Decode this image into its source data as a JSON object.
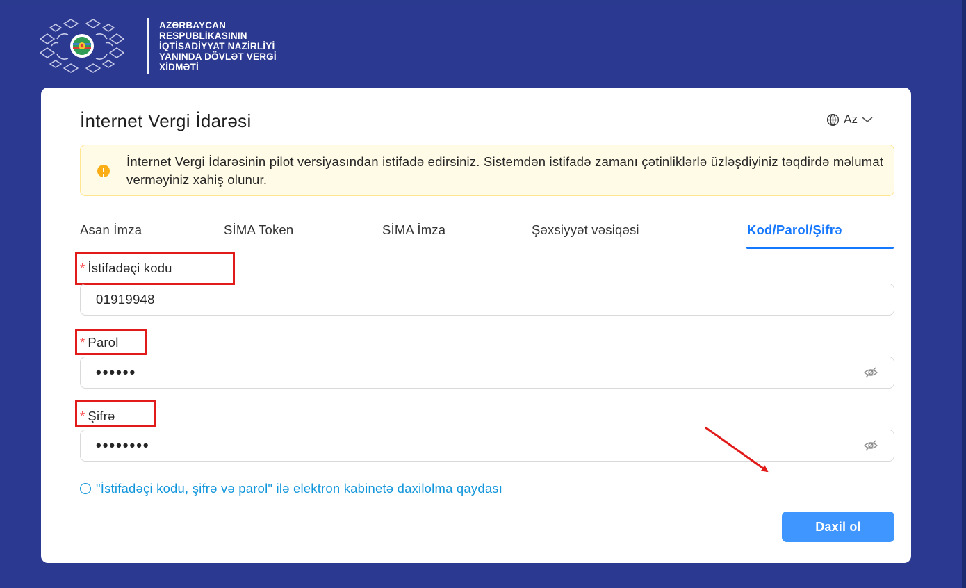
{
  "brand": {
    "lines": [
      "AZƏRBAYCAN",
      "RESPUBLİKASININ",
      "İQTİSADİYYAT NAZİRLİYİ",
      "YANINDA DÖVLƏT VERGİ",
      "XİDMƏTİ"
    ],
    "emblem_icon": "state-emblem-icon"
  },
  "card": {
    "title": "İnternet Vergi İdarəsi",
    "language": {
      "icon": "globe-icon",
      "label": "Az"
    }
  },
  "alert": {
    "icon": "warning-icon",
    "text": "İnternet Vergi İdarəsinin pilot versiyasından istifadə edirsiniz. Sistemdən istifadə zamanı çətinliklərlə üzləşdiyiniz təqdirdə məlumat verməyiniz xahiş olunur."
  },
  "tabs": {
    "items": [
      {
        "label": "Asan İmza"
      },
      {
        "label": "SİMA Token"
      },
      {
        "label": "SİMA İmza"
      },
      {
        "label": "Şəxsiyyət vəsiqəsi"
      },
      {
        "label": "Kod/Parol/Şifrə"
      }
    ],
    "active_index": 4
  },
  "form": {
    "required_marker": "*",
    "user_code": {
      "label": "İstifadəçi kodu",
      "value": "01919948"
    },
    "password": {
      "label": "Parol",
      "value": "••••••"
    },
    "pin": {
      "label": "Şifrə",
      "value": "••••••••"
    }
  },
  "info_link": {
    "icon": "info-circle-icon",
    "text": "\"İstifadəçi kodu, şifrə və parol\" ilə elektron kabinetə daxilolma qaydası"
  },
  "submit": {
    "label": "Daxil ol"
  },
  "colors": {
    "background": "#2b3990",
    "accent": "#1677ff",
    "button": "#4096ff",
    "annotation": "#e11a1a",
    "alert_bg": "#fffbe6"
  }
}
